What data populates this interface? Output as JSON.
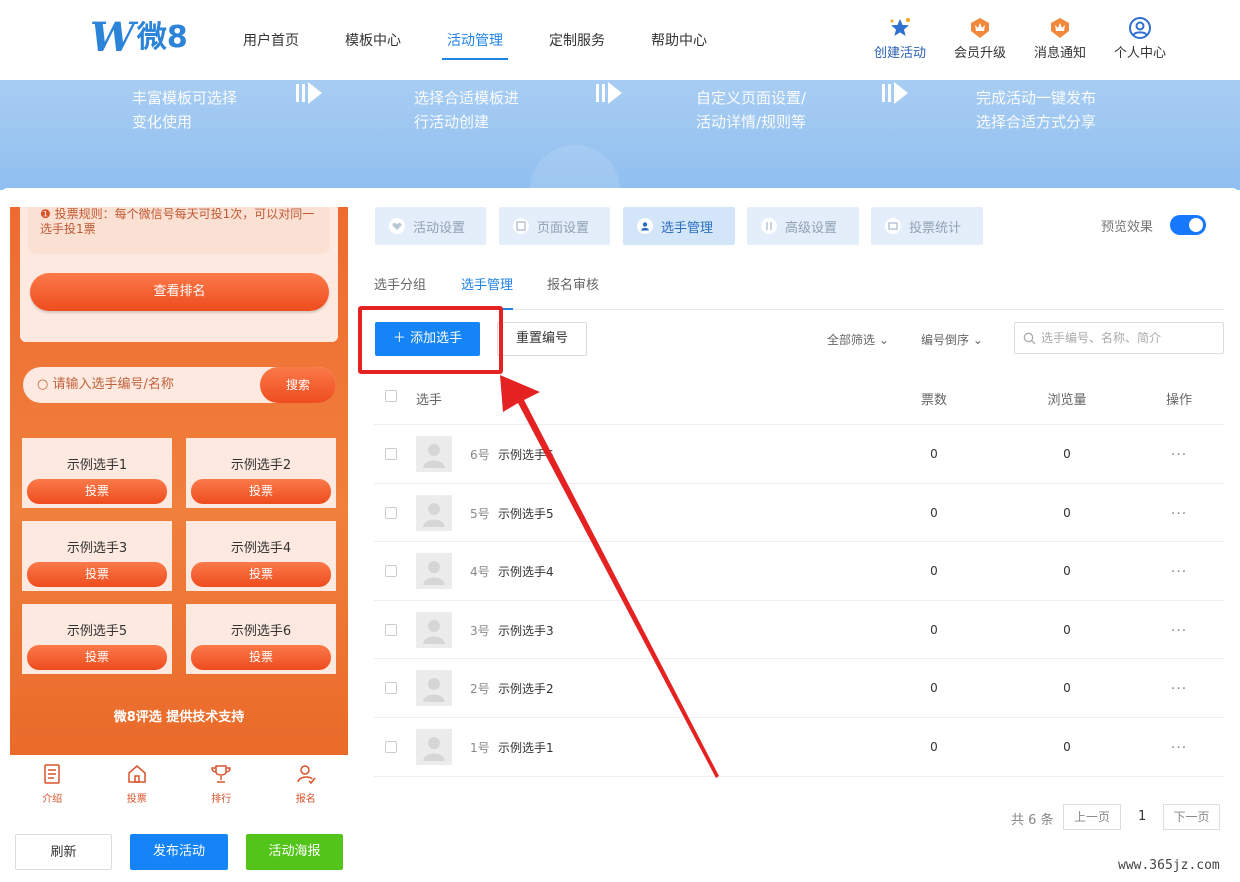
{
  "logo": {
    "letter": "W",
    "text": "微8"
  },
  "nav": [
    {
      "label": "用户首页",
      "active": false
    },
    {
      "label": "模板中心",
      "active": false
    },
    {
      "label": "活动管理",
      "active": true
    },
    {
      "label": "定制服务",
      "active": false
    },
    {
      "label": "帮助中心",
      "active": false
    }
  ],
  "tools": {
    "create": "创建活动",
    "upgrade": "会员升级",
    "notify": "消息通知",
    "profile": "个人中心"
  },
  "banner": {
    "step1": [
      "丰富模板可选择",
      "变化使用"
    ],
    "step2": [
      "选择合适模板进",
      "行活动创建"
    ],
    "step3": [
      "自定义页面设置/",
      "活动详情/规则等"
    ],
    "step4": [
      "完成活动一键发布",
      "选择合适方式分享"
    ]
  },
  "preview": {
    "rule_text": "投票规则：每个微信号每天可投1次，可以对同一选手投1票",
    "rank_button": "查看排名",
    "search_placeholder": "请输入选手编号/名称",
    "search_button": "搜索",
    "candidates": [
      "示例选手1",
      "示例选手2",
      "示例选手3",
      "示例选手4",
      "示例选手5",
      "示例选手6"
    ],
    "vote_label": "投票",
    "support": "微8评选 提供技术支持",
    "bottom_nav": [
      "介绍",
      "投票",
      "排行",
      "报名"
    ]
  },
  "actions": {
    "refresh": "刷新",
    "publish": "发布活动",
    "poster": "活动海报"
  },
  "setting_tabs": [
    "活动设置",
    "页面设置",
    "选手管理",
    "高级设置",
    "投票统计"
  ],
  "active_setting_tab": "选手管理",
  "preview_toggle": {
    "label": "预览效果",
    "on": true
  },
  "sub_tabs": [
    "选手分组",
    "选手管理",
    "报名审核"
  ],
  "toolbar": {
    "add": "添加选手",
    "renumber": "重置编号",
    "filter": "全部筛选",
    "sort": "编号倒序",
    "search_placeholder": "选手编号、名称、简介"
  },
  "table": {
    "headers": {
      "name": "选手",
      "votes": "票数",
      "views": "浏览量",
      "ops": "操作"
    },
    "rows": [
      {
        "num": "6号",
        "name": "示例选手6",
        "votes": "0",
        "views": "0"
      },
      {
        "num": "5号",
        "name": "示例选手5",
        "votes": "0",
        "views": "0"
      },
      {
        "num": "4号",
        "name": "示例选手4",
        "votes": "0",
        "views": "0"
      },
      {
        "num": "3号",
        "name": "示例选手3",
        "votes": "0",
        "views": "0"
      },
      {
        "num": "2号",
        "name": "示例选手2",
        "votes": "0",
        "views": "0"
      },
      {
        "num": "1号",
        "name": "示例选手1",
        "votes": "0",
        "views": "0"
      }
    ],
    "more_glyph": "···"
  },
  "pagination": {
    "total": "共 6 条",
    "prev": "上一页",
    "page": "1",
    "next": "下一页"
  },
  "watermark": "www.365jz.com",
  "colors": {
    "primary": "#1484f6",
    "annotation": "#e52222",
    "preview_orange": "#ee6b2f",
    "green": "#52c41a"
  }
}
